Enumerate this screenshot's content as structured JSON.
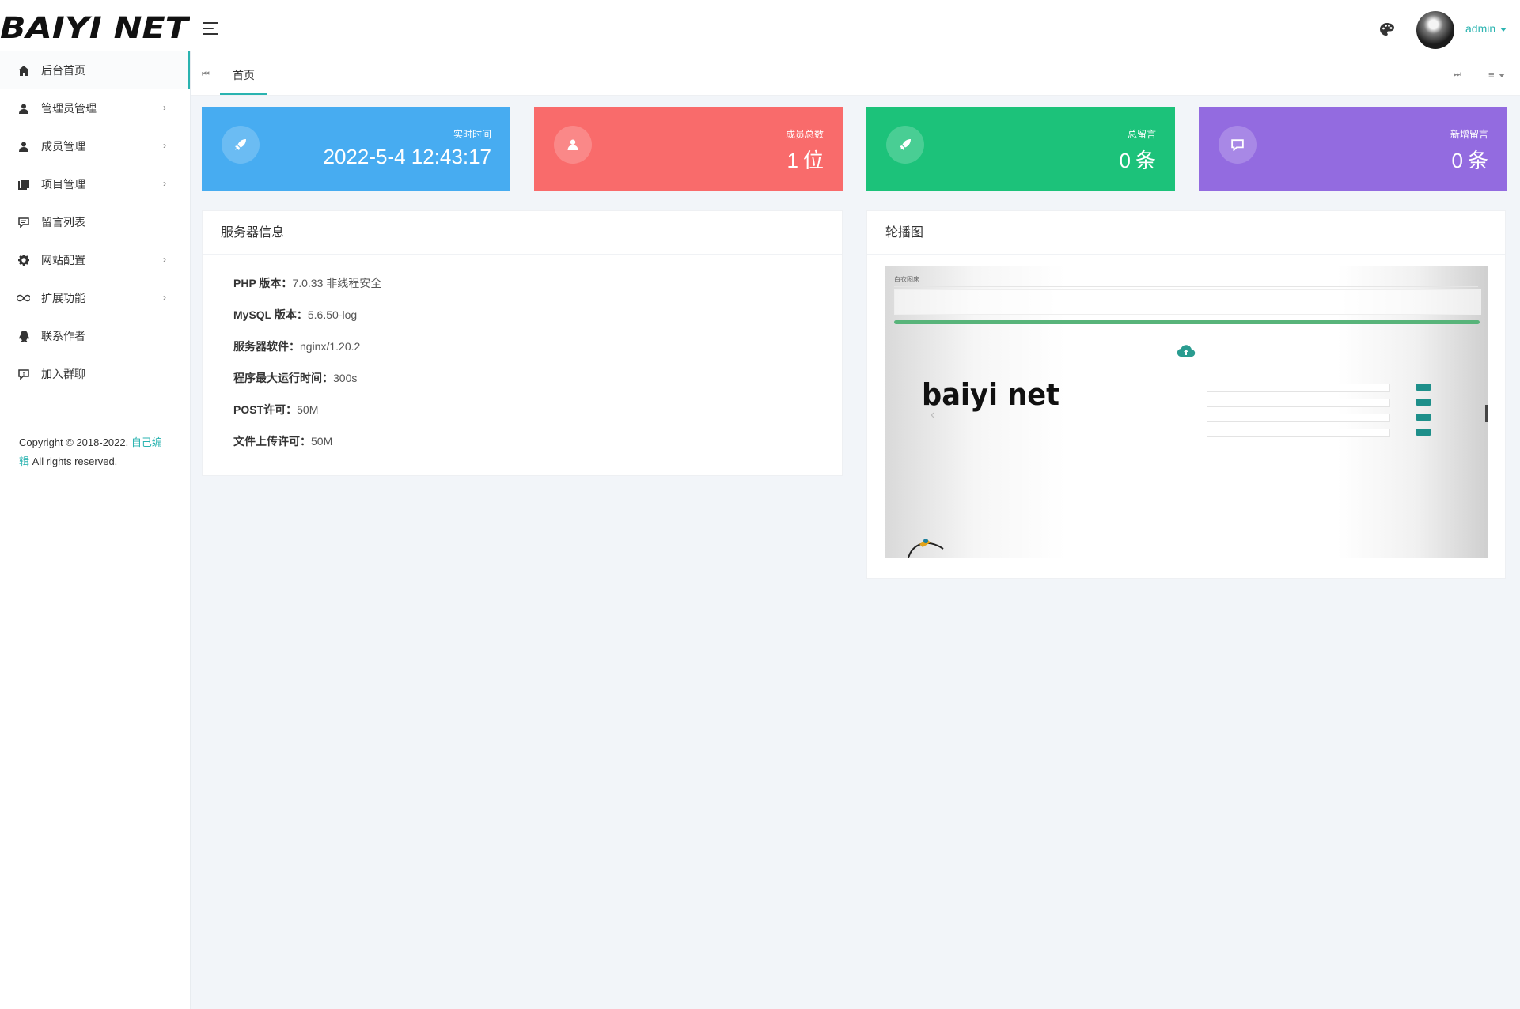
{
  "header": {
    "brand": "BAIYI NET",
    "user": "admin"
  },
  "sidebar": {
    "items": [
      {
        "label": "后台首页",
        "icon": "home-icon",
        "arrow": false,
        "active": true
      },
      {
        "label": "管理员管理",
        "icon": "user-icon",
        "arrow": true
      },
      {
        "label": "成员管理",
        "icon": "user-icon",
        "arrow": true
      },
      {
        "label": "项目管理",
        "icon": "book-icon",
        "arrow": true
      },
      {
        "label": "留言列表",
        "icon": "comment-icon",
        "arrow": false
      },
      {
        "label": "网站配置",
        "icon": "gear-icon",
        "arrow": true
      },
      {
        "label": "扩展功能",
        "icon": "infinity-icon",
        "arrow": true
      },
      {
        "label": "联系作者",
        "icon": "qq-icon",
        "arrow": false
      },
      {
        "label": "加入群聊",
        "icon": "chat-icon",
        "arrow": false
      }
    ],
    "arrow_glyph": "›",
    "copyright_prefix": "Copyright © 2018-2022.",
    "copyright_link": "自己编辑",
    "copyright_suffix": "All rights reserved."
  },
  "tabs": {
    "prev_glyph": "⏮",
    "home": "首页",
    "next_glyph": "⏭",
    "menu_glyph": "≡"
  },
  "stats": [
    {
      "label": "实时时间",
      "value": "2022-5-4 12:43:17",
      "unit": "",
      "color": "#47acf1",
      "icon": "rocket-icon"
    },
    {
      "label": "成员总数",
      "value": "1",
      "unit": "位",
      "color": "#f96b6b",
      "icon": "user-icon"
    },
    {
      "label": "总留言",
      "value": "0",
      "unit": "条",
      "color": "#1cc27a",
      "icon": "rocket-icon"
    },
    {
      "label": "新增留言",
      "value": "0",
      "unit": "条",
      "color": "#936be0",
      "icon": "comment-icon"
    }
  ],
  "server": {
    "title": "服务器信息",
    "rows": [
      {
        "key": "PHP 版本：",
        "value": "7.0.33 非线程安全"
      },
      {
        "key": "MySQL 版本：",
        "value": "5.6.50-log"
      },
      {
        "key": "服务器软件：",
        "value": "nginx/1.20.2"
      },
      {
        "key": "程序最大运行时间：",
        "value": "300s"
      },
      {
        "key": "POST许可：",
        "value": "50M"
      },
      {
        "key": "文件上传许可：",
        "value": "50M"
      }
    ]
  },
  "carousel": {
    "title": "轮播图",
    "prev_glyph": "‹",
    "slide_brand": "baiyi net",
    "slide_head": "白衣图床"
  },
  "colors": {
    "accent": "#2ab3b0",
    "background": "#f2f5f9"
  }
}
